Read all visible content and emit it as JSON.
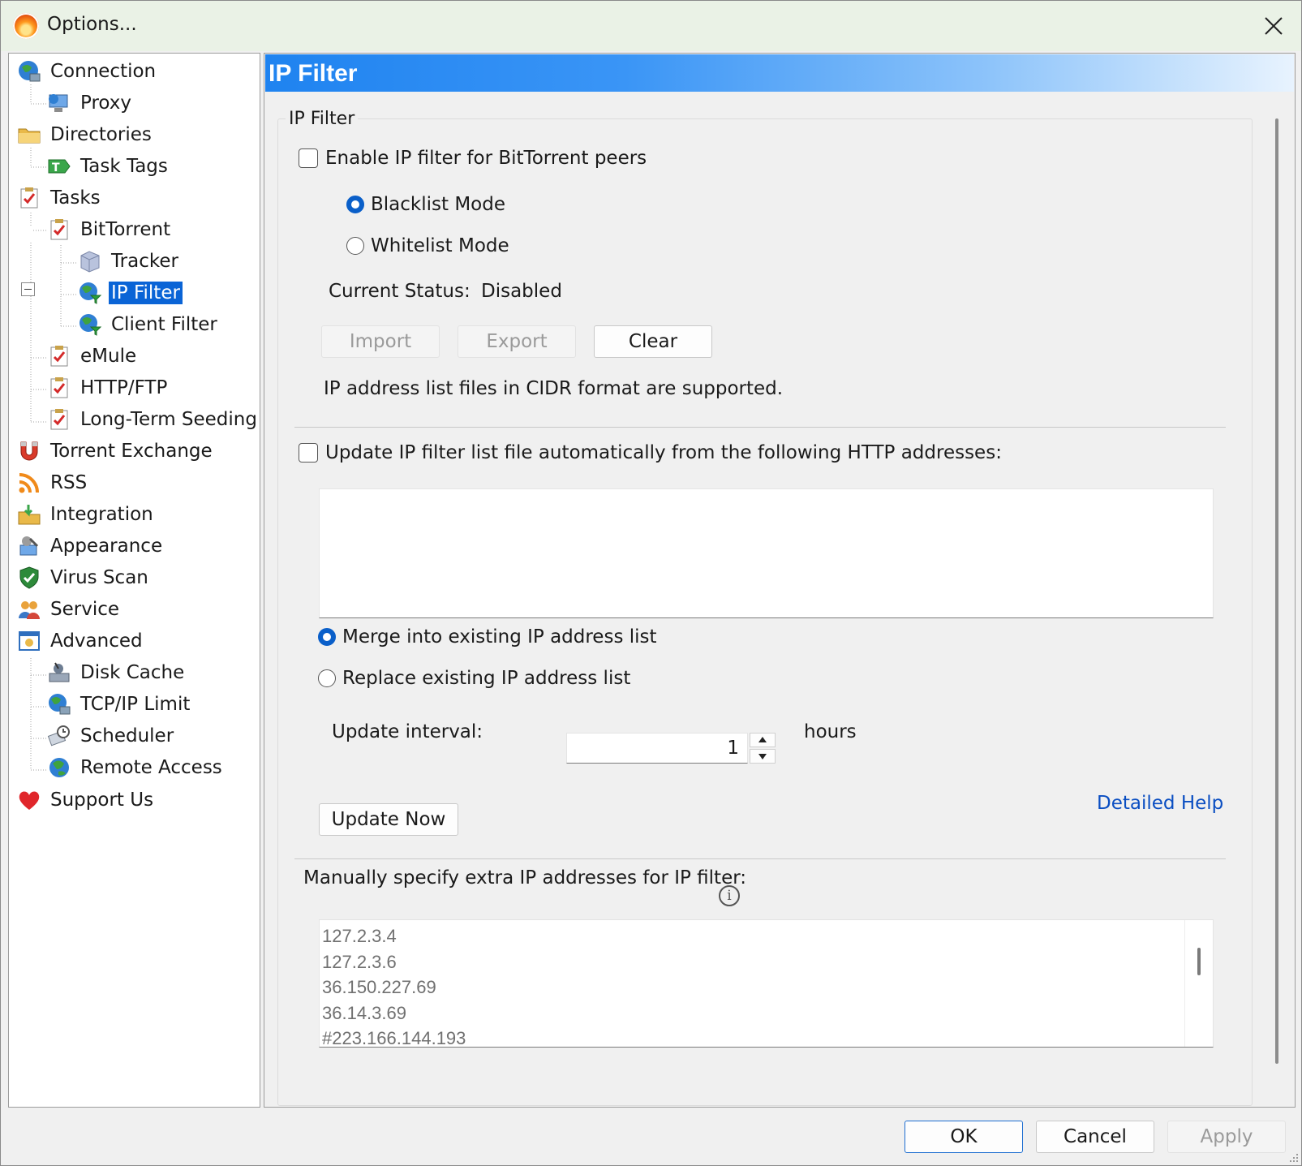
{
  "window": {
    "title": "Options..."
  },
  "tree": {
    "items": [
      {
        "label": "Connection",
        "icon": "globe-network-icon"
      },
      {
        "label": "Proxy",
        "icon": "proxy-computer-icon"
      },
      {
        "label": "Directories",
        "icon": "folder-icon"
      },
      {
        "label": "Task Tags",
        "icon": "tag-icon"
      },
      {
        "label": "Tasks",
        "icon": "task-checklist-icon"
      },
      {
        "label": "BitTorrent",
        "icon": "task-checklist-icon"
      },
      {
        "label": "Tracker",
        "icon": "tracker-cube-icon"
      },
      {
        "label": "IP Filter",
        "icon": "globe-filter-icon",
        "selected": true
      },
      {
        "label": "Client Filter",
        "icon": "globe-filter-icon"
      },
      {
        "label": "eMule",
        "icon": "task-checklist-icon"
      },
      {
        "label": "HTTP/FTP",
        "icon": "task-checklist-icon"
      },
      {
        "label": "Long-Term Seeding",
        "icon": "task-checklist-icon"
      },
      {
        "label": "Torrent Exchange",
        "icon": "magnet-icon"
      },
      {
        "label": "RSS",
        "icon": "rss-icon"
      },
      {
        "label": "Integration",
        "icon": "integration-folder-icon"
      },
      {
        "label": "Appearance",
        "icon": "appearance-icon"
      },
      {
        "label": "Virus Scan",
        "icon": "shield-check-icon"
      },
      {
        "label": "Service",
        "icon": "users-icon"
      },
      {
        "label": "Advanced",
        "icon": "advanced-window-icon"
      },
      {
        "label": "Disk Cache",
        "icon": "disk-cache-icon"
      },
      {
        "label": "TCP/IP Limit",
        "icon": "globe-network-icon"
      },
      {
        "label": "Scheduler",
        "icon": "scheduler-icon"
      },
      {
        "label": "Remote Access",
        "icon": "globe-icon"
      },
      {
        "label": "Support Us",
        "icon": "heart-icon"
      }
    ]
  },
  "panel": {
    "banner_title": "IP Filter",
    "group_title": "IP Filter",
    "enable_filter": {
      "label": "Enable IP filter for BitTorrent peers",
      "checked": false
    },
    "mode": {
      "blacklist": "Blacklist Mode",
      "whitelist": "Whitelist Mode",
      "selected": "blacklist"
    },
    "status": {
      "label": "Current Status:",
      "value": "Disabled"
    },
    "buttons": {
      "import": "Import",
      "export": "Export",
      "clear": "Clear"
    },
    "cidr_note": "IP address list files in CIDR format are supported.",
    "auto_update": {
      "label": "Update IP filter list file automatically from the following HTTP addresses:",
      "checked": false,
      "urls": ""
    },
    "merge_mode": {
      "merge": "Merge into existing IP address list",
      "replace": "Replace existing IP address list",
      "selected": "merge"
    },
    "interval": {
      "label": "Update interval:",
      "value": "1",
      "unit": "hours"
    },
    "update_now": "Update Now",
    "help_link": "Detailed Help",
    "manual": {
      "label": "Manually specify extra IP addresses for IP filter:",
      "lines": [
        "127.2.3.4",
        "127.2.3.6",
        "36.150.227.69",
        "36.14.3.69",
        "#223.166.144.193"
      ]
    }
  },
  "footer": {
    "ok": "OK",
    "cancel": "Cancel",
    "apply": "Apply"
  },
  "colors": {
    "accent": "#0a64d6",
    "banner_start": "#1f83f0",
    "link": "#0a4ec2"
  }
}
